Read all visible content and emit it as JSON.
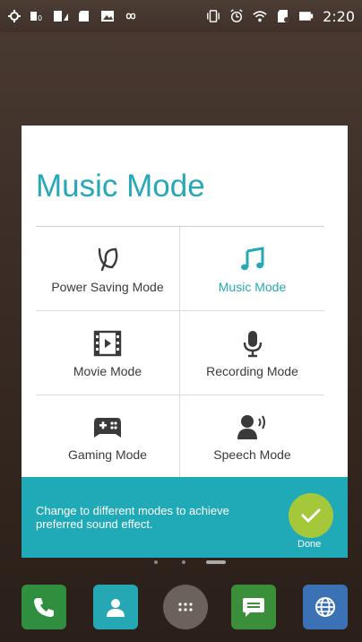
{
  "status_bar": {
    "time": "2:20",
    "left_icons": [
      "location-icon",
      "signal-x-icon",
      "sim-icon",
      "sd-card-icon",
      "image-icon",
      "infinity-icon"
    ],
    "right_icons": [
      "vibrate-icon",
      "alarm-icon",
      "wifi-icon",
      "sd-icon",
      "battery-icon"
    ]
  },
  "dialog": {
    "title": "Music Mode",
    "modes": [
      {
        "label": "Power Saving Mode",
        "icon": "leaf-icon",
        "active": false
      },
      {
        "label": "Music Mode",
        "icon": "music-note-icon",
        "active": true
      },
      {
        "label": "Movie Mode",
        "icon": "film-icon",
        "active": false
      },
      {
        "label": "Recording Mode",
        "icon": "microphone-icon",
        "active": false
      },
      {
        "label": "Gaming Mode",
        "icon": "gamepad-icon",
        "active": false
      },
      {
        "label": "Speech Mode",
        "icon": "speech-icon",
        "active": false
      }
    ]
  },
  "info": {
    "text": "Change to different modes to achieve preferred sound effect.",
    "done_label": "Done"
  },
  "dock": {
    "apps": [
      "phone-icon",
      "contacts-icon",
      "app-drawer-icon",
      "messages-icon",
      "browser-icon"
    ]
  },
  "colors": {
    "accent": "#27a8b6",
    "info_bar": "#20a9b6",
    "done_button": "#a5c83b"
  }
}
